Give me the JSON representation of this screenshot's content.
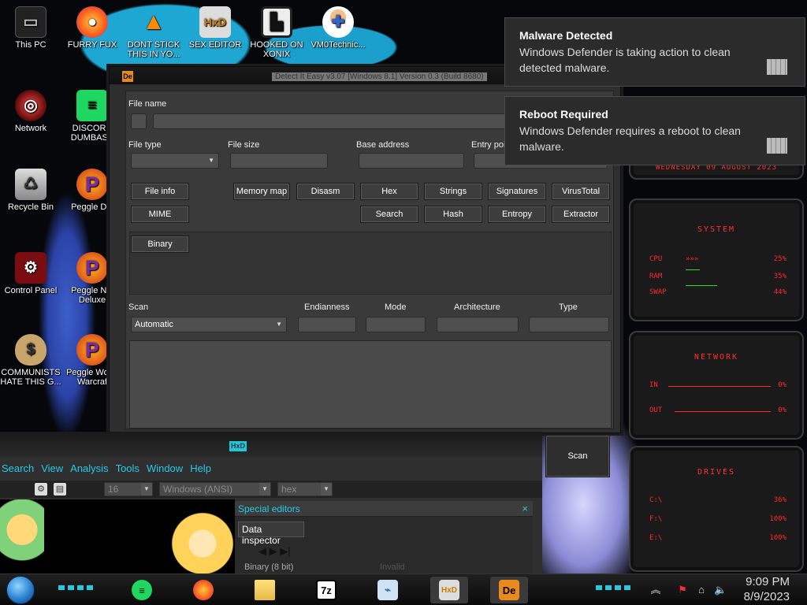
{
  "desktop": {
    "icons": [
      {
        "name": "this-pc-icon",
        "label": "This PC"
      },
      {
        "name": "firefox-icon",
        "label": "FURRY FUX"
      },
      {
        "name": "vlc-icon",
        "label": "DONT STICK THIS IN YO..."
      },
      {
        "name": "hxd-icon",
        "label": "SEX EDITOR"
      },
      {
        "name": "game-icon",
        "label": "HOOKED ON XONIX"
      },
      {
        "name": "vm-icon",
        "label": "VM0Technic..."
      },
      {
        "name": "network-icon",
        "label": "Network"
      },
      {
        "name": "discord-icon",
        "label": "DISCORD DUMBASS"
      },
      {
        "name": "recycle-bin-icon",
        "label": "Recycle Bin"
      },
      {
        "name": "peggle-icon-1",
        "label": "Peggle Del"
      },
      {
        "name": "control-panel-icon",
        "label": "Control Panel"
      },
      {
        "name": "peggle-icon-2",
        "label": "Peggle Nig Deluxe"
      },
      {
        "name": "money-bag-icon",
        "label": "COMMUNISTS HATE THIS G..."
      },
      {
        "name": "peggle-icon-3",
        "label": "Peggle Wo of Warcraf"
      }
    ]
  },
  "die": {
    "title": "Detect It Easy v3.07 [Windows 8.1] Version 0.3 (Build 8680)",
    "file_name_label": "File name",
    "file_type_label": "File type",
    "file_size_label": "File size",
    "base_address_label": "Base address",
    "entry_point_label": "Entry poi",
    "buttons": {
      "file_info": "File info",
      "memory_map": "Memory map",
      "disasm": "Disasm",
      "hex": "Hex",
      "strings": "Strings",
      "signatures": "Signatures",
      "virustotal": "VirusTotal",
      "mime": "MIME",
      "search": "Search",
      "hash": "Hash",
      "entropy": "Entropy",
      "extractor": "Extractor",
      "binary": "Binary",
      "scan": "Scan"
    },
    "scan_label": "Scan",
    "scan_value": "Automatic",
    "endianness_label": "Endianness",
    "mode_label": "Mode",
    "architecture_label": "Architecture",
    "type_label": "Type"
  },
  "hxd": {
    "title_badge": "HxD",
    "menu": [
      "Search",
      "View",
      "Analysis",
      "Tools",
      "Window",
      "Help"
    ],
    "toolbar": {
      "columns": "16",
      "charset": "Windows (ANSI)",
      "offset_base": "hex"
    },
    "special_editors_title": "Special editors",
    "data_inspector_tab": "Data inspector",
    "binary_row_label": "Binary (8 bit)",
    "binary_row_value": "Invalid"
  },
  "notifications": [
    {
      "title": "Malware Detected",
      "message": "Windows Defender is taking action to clean detected malware."
    },
    {
      "title": "Reboot Required",
      "message": "Windows Defender requires a reboot to clean malware."
    }
  ],
  "widgets": {
    "date": "WEDNESDAY 09 AUGUST 2023",
    "system": {
      "title": "SYSTEM",
      "rows": [
        {
          "label": "CPU",
          "value": "25%"
        },
        {
          "label": "RAM",
          "value": "35%"
        },
        {
          "label": "SWAP",
          "value": "44%"
        }
      ]
    },
    "network": {
      "title": "NETWORK",
      "rows": [
        {
          "label": "IN",
          "value": "0%"
        },
        {
          "label": "OUT",
          "value": "0%"
        }
      ]
    },
    "drives": {
      "title": "DRIVES",
      "rows": [
        {
          "label": "C:\\",
          "value": "36%"
        },
        {
          "label": "F:\\",
          "value": "100%"
        },
        {
          "label": "E:\\",
          "value": "100%"
        }
      ]
    }
  },
  "taskbar": {
    "apps": [
      "spotify-icon",
      "firefox-icon",
      "file-explorer-icon",
      "7zip-icon",
      "task-manager-icon",
      "hxd-icon",
      "die-icon"
    ],
    "seven_zip_label": "7z",
    "die_label": "De",
    "hxd_label": "HxD",
    "time": "9:09 PM",
    "date": "8/9/2023"
  }
}
